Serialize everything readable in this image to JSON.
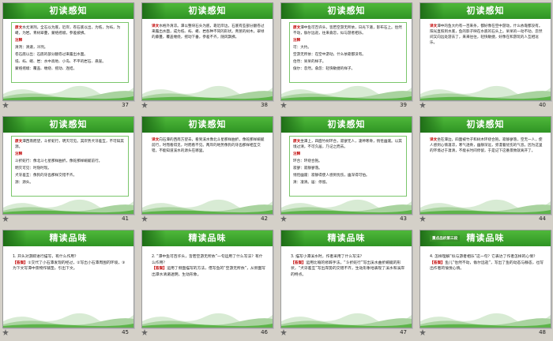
{
  "slides": [
    {
      "title": "初读感知",
      "number": "37",
      "kind": "box",
      "lines": [
        {
          "label": "原文",
          "text": "水尤清冽。全石以为底，近岸，卷石底以出，为坻，为屿，为嵁，为岩。青树翠蔓，蒙络摇缀，参差披拂。"
        },
        {
          "label": "注释",
          "text": ""
        },
        {
          "label": "",
          "text": "清冽：清澈，冷冽。"
        },
        {
          "label": "",
          "text": "卷石底以出：石底的部分翻卷过来露出水面。"
        },
        {
          "label": "",
          "text": "坻、屿、嵁、岩：水中高地、小岛、不平的岩石、悬崖。"
        },
        {
          "label": "",
          "text": "蒙络摇缀：覆盖、缠绕、摇动、连结。"
        }
      ]
    },
    {
      "title": "初读感知",
      "number": "38",
      "kind": "plain",
      "lines": [
        {
          "label": "译文",
          "text": ""
        },
        {
          "label": "",
          "text": "水格外清凉。潭以整块石头为底，靠近岸边，石底有些部分翻卷过来露出水面，成为坻、屿、嵁、岩各种不同的形状。青葱的树木，翠绿的藤蔓，覆盖缠绕，摇动下垂，参差不齐，随风飘拂。"
        }
      ]
    },
    {
      "title": "初读感知",
      "number": "39",
      "kind": "box",
      "lines": [
        {
          "label": "原文",
          "text": "潭中鱼可百许头，皆若空游无所依，日光下澈，影布石上。佁然不动，俶尔远逝，往来翕忽，似与游者相乐。"
        },
        {
          "label": "注释",
          "text": ""
        },
        {
          "label": "",
          "text": "可：大约。"
        },
        {
          "label": "",
          "text": "空游无所依：在空中游动，什么依靠都没有。"
        },
        {
          "label": "",
          "text": "佁然：呆呆的样子。"
        },
        {
          "label": "",
          "text": "俶尔：忽然。翕忽：轻快敏捷的样子。"
        }
      ]
    },
    {
      "title": "初读感知",
      "number": "40",
      "kind": "plain",
      "lines": [
        {
          "label": "译文",
          "text": ""
        },
        {
          "label": "",
          "text": "潭中的鱼大约有一百来条，都好像在空中游动，什么依靠都没有。阳光直照到水底，鱼的影子映在水底的石头上。呆呆的一动不动，忽然间又向远处游去了，来来往往，轻快敏捷，好像在和游玩的人互相逗乐。"
        }
      ]
    },
    {
      "title": "初读感知",
      "number": "41",
      "kind": "box",
      "lines": [
        {
          "label": "原文",
          "text": "潭西南而望，斗折蛇行，明灭可见。其岸势犬牙差互，不可知其源。"
        },
        {
          "label": "注释",
          "text": ""
        },
        {
          "label": "",
          "text": "斗折蛇行：像北斗七星那样曲折，像蛇那样蜿蜒前行。"
        },
        {
          "label": "",
          "text": "明灭可见：时隐时现。"
        },
        {
          "label": "",
          "text": "犬牙差互：像狗的牙齿那样交错不齐。"
        },
        {
          "label": "",
          "text": "源：源头。"
        }
      ]
    },
    {
      "title": "初读感知",
      "number": "42",
      "kind": "plain",
      "lines": [
        {
          "label": "译文",
          "text": ""
        },
        {
          "label": "",
          "text": "向石潭的西南方望去，看到溪水像北斗星那样曲折，像蛇那样蜿蜒前行，时而看得见，时而看不见。两岸的地势像狗的牙齿那样相互交错，不能知道溪水的源头在哪里。"
        }
      ]
    },
    {
      "title": "初读感知",
      "number": "43",
      "kind": "box",
      "lines": [
        {
          "label": "原文",
          "text": "坐潭上，四面竹树环合，寂寥无人，凄神寒骨，悄怆幽邃。以其境过清，不可久居，乃记之而去。"
        },
        {
          "label": "注释",
          "text": ""
        },
        {
          "label": "",
          "text": "环合：环绕合抱。"
        },
        {
          "label": "",
          "text": "寂寥：寂静寥落。"
        },
        {
          "label": "",
          "text": "悄怆幽邃：寂静得使人感到忧伤，幽深得可怕。"
        },
        {
          "label": "",
          "text": "清：凄清。居：停留。"
        }
      ]
    },
    {
      "title": "初读感知",
      "number": "44",
      "kind": "plain",
      "lines": [
        {
          "label": "译文",
          "text": ""
        },
        {
          "label": "",
          "text": "坐在潭边，四面被竹子和树木环绕合抱，寂静寥落，空无一人，使人感到心情凄凉，寒气透骨，幽静深远，弥漫着忧伤的气息。因为这里的环境过于凄清，不能长时间停留，于是记下这番景致就离开了。"
        }
      ]
    },
    {
      "title": "精读品味",
      "number": "45",
      "kind": "q",
      "question": "1. 开头对游踪进行描写，有什么作用？",
      "answer_label": "【答案】",
      "answer": "①交代了小石潭发现的经过，②写出小石潭周围的环境，③为下文写潭中景物作铺垫，引出下文。"
    },
    {
      "title": "精读品味",
      "number": "46",
      "kind": "q",
      "question": "2. “潭中鱼可百许头，皆若空游无所依”一句运用了什么写法？有什么作用？",
      "answer_label": "【答案】",
      "answer": "运用了侧面描写的方法，借写鱼的“空游无所依”，从侧面写出潭水清澈透明，生动形象。"
    },
    {
      "title": "精读品味",
      "number": "47",
      "kind": "q",
      "question": "3. 描写小潭溪水时，作者采用了什么写法？",
      "answer_label": "【答案】",
      "answer": "运用比喻的修辞手法，“斗折蛇行”写出溪水曲折蜿蜒的形状，“犬牙差互”写出岸势的交错不齐，生动形象地表现了溪水和溪岸的特点。"
    },
    {
      "title": "精读品味",
      "number": "48",
      "kind": "q2",
      "tag": "重点品析第三段",
      "question": "4. 怎样理解“似与游者相乐”这一句？它表达了作者怎样的心情？",
      "answer_label": "【答案】",
      "answer": "鱼儿“佁然不动，俶尔远逝”，写出了鱼的动态与静态，也写出作者的愉悦心情。"
    }
  ],
  "colors": {
    "banner": "#3aa52c",
    "accent": "#c00000",
    "border": "#7bc66b"
  }
}
